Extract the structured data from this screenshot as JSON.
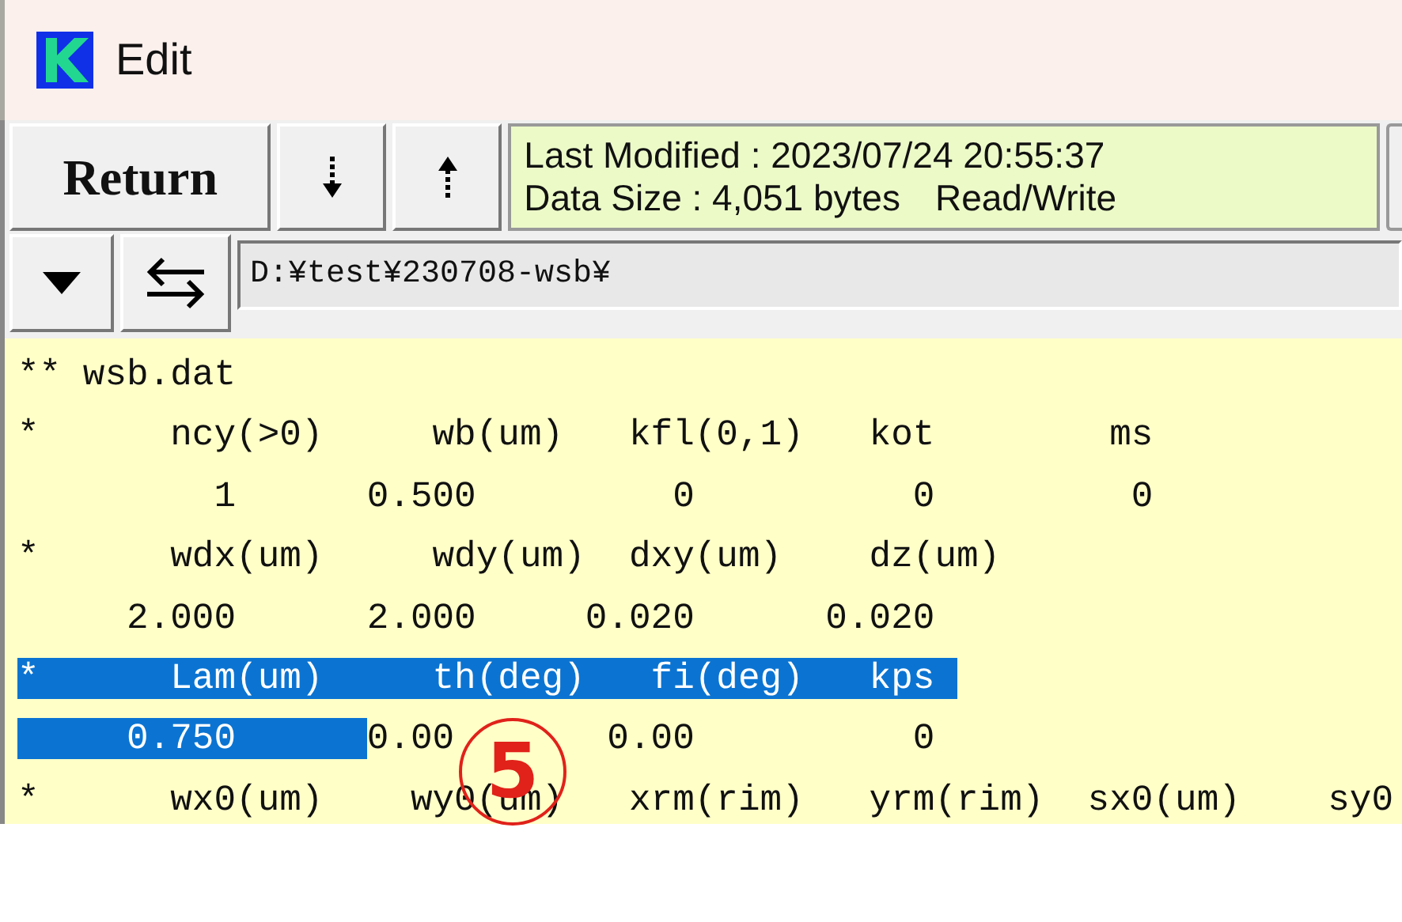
{
  "window": {
    "title": "Edit"
  },
  "toolbar": {
    "return_button": "Return",
    "info": {
      "modified": "Last Modified : 2023/07/24 20:55:37",
      "size": "Data Size : 4,051 bytes",
      "access": "Read/Write"
    }
  },
  "path_field": {
    "value": "D:¥test¥230708-wsb¥"
  },
  "editor": {
    "lines": [
      {
        "segments": [
          {
            "text": "** wsb.dat",
            "selected": false
          }
        ]
      },
      {
        "segments": [
          {
            "text": "*      ncy(>0)     wb(um)   kfl(0,1)   kot        ms",
            "selected": false
          }
        ]
      },
      {
        "segments": [
          {
            "text": "         1      0.500         0          0         0",
            "selected": false
          }
        ]
      },
      {
        "segments": [
          {
            "text": "*      wdx(um)     wdy(um)  dxy(um)    dz(um)",
            "selected": false
          }
        ]
      },
      {
        "segments": [
          {
            "text": "     2.000      2.000     0.020      0.020",
            "selected": false
          }
        ]
      },
      {
        "segments": [
          {
            "text": "*      Lam(um)     th(deg)   fi(deg)   kps ",
            "selected": true
          }
        ]
      },
      {
        "segments": [
          {
            "text": "     0.750      ",
            "selected": true
          },
          {
            "text": "0.00       0.00          0",
            "selected": false
          }
        ]
      },
      {
        "segments": [
          {
            "text": "*      wx0(um)    wy0(um)   xrm(rim)   yrm(rim)  sx0(um)    sy0",
            "selected": false
          }
        ]
      }
    ]
  },
  "annotation": {
    "label": "5"
  }
}
